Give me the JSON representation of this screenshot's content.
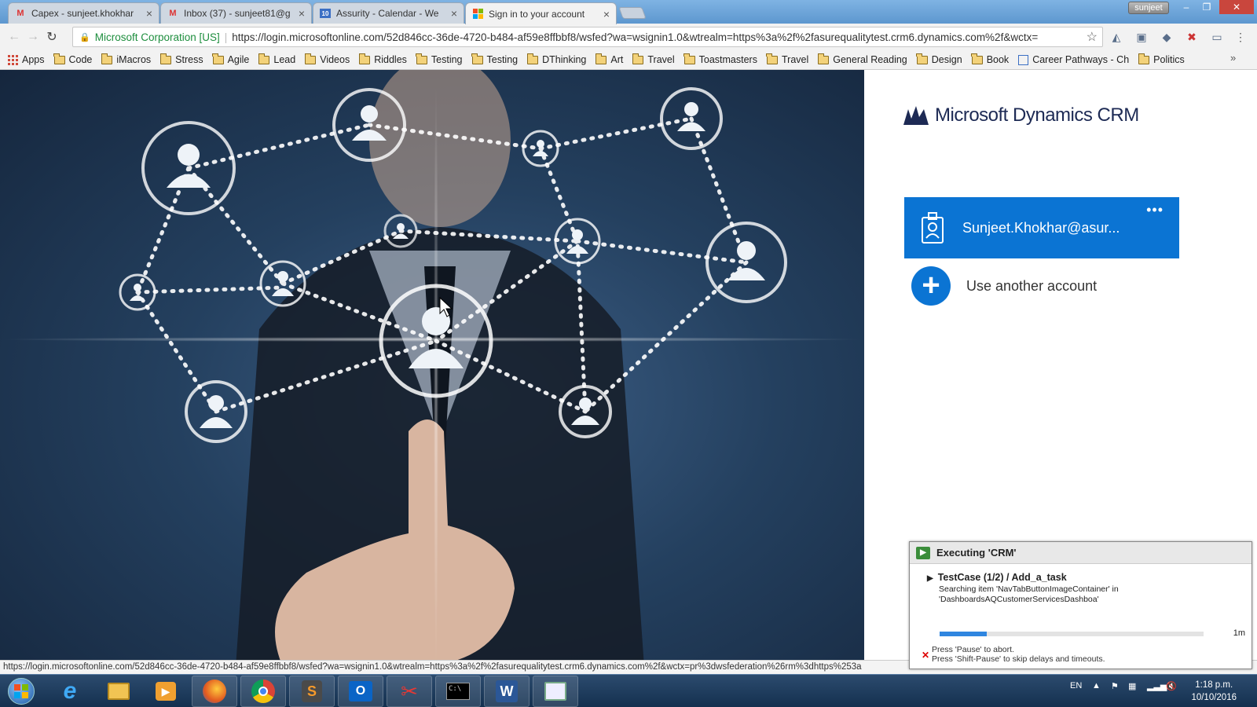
{
  "tabs": [
    {
      "title": "Capex - sunjeet.khokhar",
      "icon": "gmail-icon",
      "active": false
    },
    {
      "title": "Inbox (37) - sunjeet81@g",
      "icon": "gmail-icon",
      "active": false
    },
    {
      "title": "Assurity - Calendar - We",
      "icon": "calendar-icon",
      "active": false
    },
    {
      "title": "Sign in to your account",
      "icon": "microsoft-icon",
      "active": true
    }
  ],
  "profile_name": "sunjeet",
  "address": {
    "org": "Microsoft Corporation [US]",
    "url": "https://login.microsoftonline.com/52d846cc-36de-4720-b484-af59e8ffbbf8/wsfed?wa=wsignin1.0&wtrealm=https%3a%2f%2fasurequalitytest.crm6.dynamics.com%2f&wctx="
  },
  "bookmarks": [
    "Apps",
    "Code",
    "iMacros",
    "Stress",
    "Agile",
    "Lead",
    "Videos",
    "Riddles",
    "Testing",
    "Testing",
    "DThinking",
    "Art",
    "Travel",
    "Toastmasters",
    "Travel",
    "General Reading",
    "Design",
    "Book",
    "Career Pathways - Ch",
    "Politics"
  ],
  "signin": {
    "brand": "Microsoft Dynamics CRM",
    "account_email": "Sunjeet.Khokhar@asur...",
    "more": "•••",
    "other_account": "Use another account"
  },
  "status_url": "https://login.microsoftonline.com/52d846cc-36de-4720-b484-af59e8ffbbf8/wsfed?wa=wsignin1.0&wtrealm=https%3a%2f%2fasurequalitytest.crm6.dynamics.com%2f&wctx=pr%3dwsfederation%26rm%3dhttps%253a",
  "executing": {
    "title": "Executing 'CRM'",
    "testcase": "TestCase (1/2) / Add_a_task",
    "searching": "Searching item 'NavTabButtonImageContainer' in 'DashboardsAQCustomerServicesDashboa'",
    "progress": 0.18,
    "time": "1m",
    "pause1": "Press 'Pause' to abort.",
    "pause2": "Press 'Shift-Pause' to skip delays and timeouts."
  },
  "taskbar": {
    "lang": "EN",
    "time": "1:18 p.m.",
    "date": "10/10/2016"
  }
}
